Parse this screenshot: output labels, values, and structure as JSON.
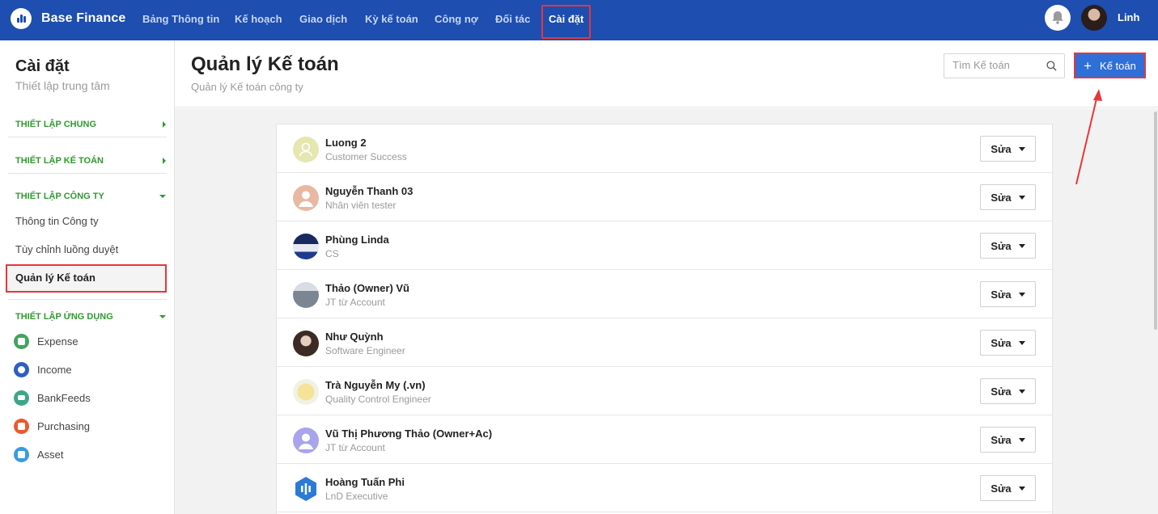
{
  "topbar": {
    "brand": "Base Finance",
    "nav": [
      {
        "label": "Bảng Thông tin",
        "active": false
      },
      {
        "label": "Kế hoạch",
        "active": false
      },
      {
        "label": "Giao dịch",
        "active": false
      },
      {
        "label": "Kỳ kế toán",
        "active": false
      },
      {
        "label": "Công nợ",
        "active": false
      },
      {
        "label": "Đối tác",
        "active": false
      },
      {
        "label": "Cài đặt",
        "active": true
      }
    ],
    "user_name": "Linh",
    "icons": {
      "notification": "bell-icon",
      "brand": "chart-logo-icon"
    }
  },
  "sidebar": {
    "title": "Cài đặt",
    "subtitle": "Thiết lập trung tâm",
    "sections": [
      {
        "label": "THIẾT LẬP CHUNG",
        "expanded": false
      },
      {
        "label": "THIẾT LẬP KẾ TOÁN",
        "expanded": false
      },
      {
        "label": "THIẾT LẬP CÔNG TY",
        "expanded": true
      },
      {
        "label": "THIẾT LẬP ỨNG DỤNG",
        "expanded": true
      }
    ],
    "company_links": [
      "Thông tin Công ty",
      "Tùy chỉnh luồng duyệt",
      "Quản lý Kế toán"
    ],
    "active_link": "Quản lý Kế toán",
    "apps": [
      {
        "label": "Expense",
        "color": "#3fa55b"
      },
      {
        "label": "Income",
        "color": "#2d5fc4"
      },
      {
        "label": "BankFeeds",
        "color": "#3fa58a"
      },
      {
        "label": "Purchasing",
        "color": "#e95a2f"
      },
      {
        "label": "Asset",
        "color": "#3a9be0"
      }
    ]
  },
  "header": {
    "title": "Quản lý Kế toán",
    "subtitle": "Quản lý Kế toán công ty",
    "search_placeholder": "Tìm Kế toán",
    "add_button": "Kế toán"
  },
  "accountants": [
    {
      "name": "Luong 2",
      "role": "Customer Success",
      "avatar": "placeholder"
    },
    {
      "name": "Nguyễn Thanh 03",
      "role": "Nhân viên tester",
      "avatar": "placeholder"
    },
    {
      "name": "Phùng Linda",
      "role": "CS",
      "avatar": "photo"
    },
    {
      "name": "Thảo (Owner) Vũ",
      "role": "JT từ Account",
      "avatar": "photo"
    },
    {
      "name": "Như Quỳnh",
      "role": "Software Engineer",
      "avatar": "photo"
    },
    {
      "name": "Trà Nguyễn My (.vn)",
      "role": "Quality Control Engineer",
      "avatar": "photo"
    },
    {
      "name": "Vũ Thị Phương Thảo (Owner+Ac)",
      "role": "JT từ Account",
      "avatar": "placeholder"
    },
    {
      "name": "Hoàng Tuấn Phi",
      "role": "LnD Executive",
      "avatar": "logo"
    }
  ],
  "row_action": "Sửa",
  "colors": {
    "topbar": "#1d4eb0",
    "primary_button": "#2f6fd8",
    "section_green": "#2e9a2e",
    "highlight_red": "#e8363a"
  }
}
